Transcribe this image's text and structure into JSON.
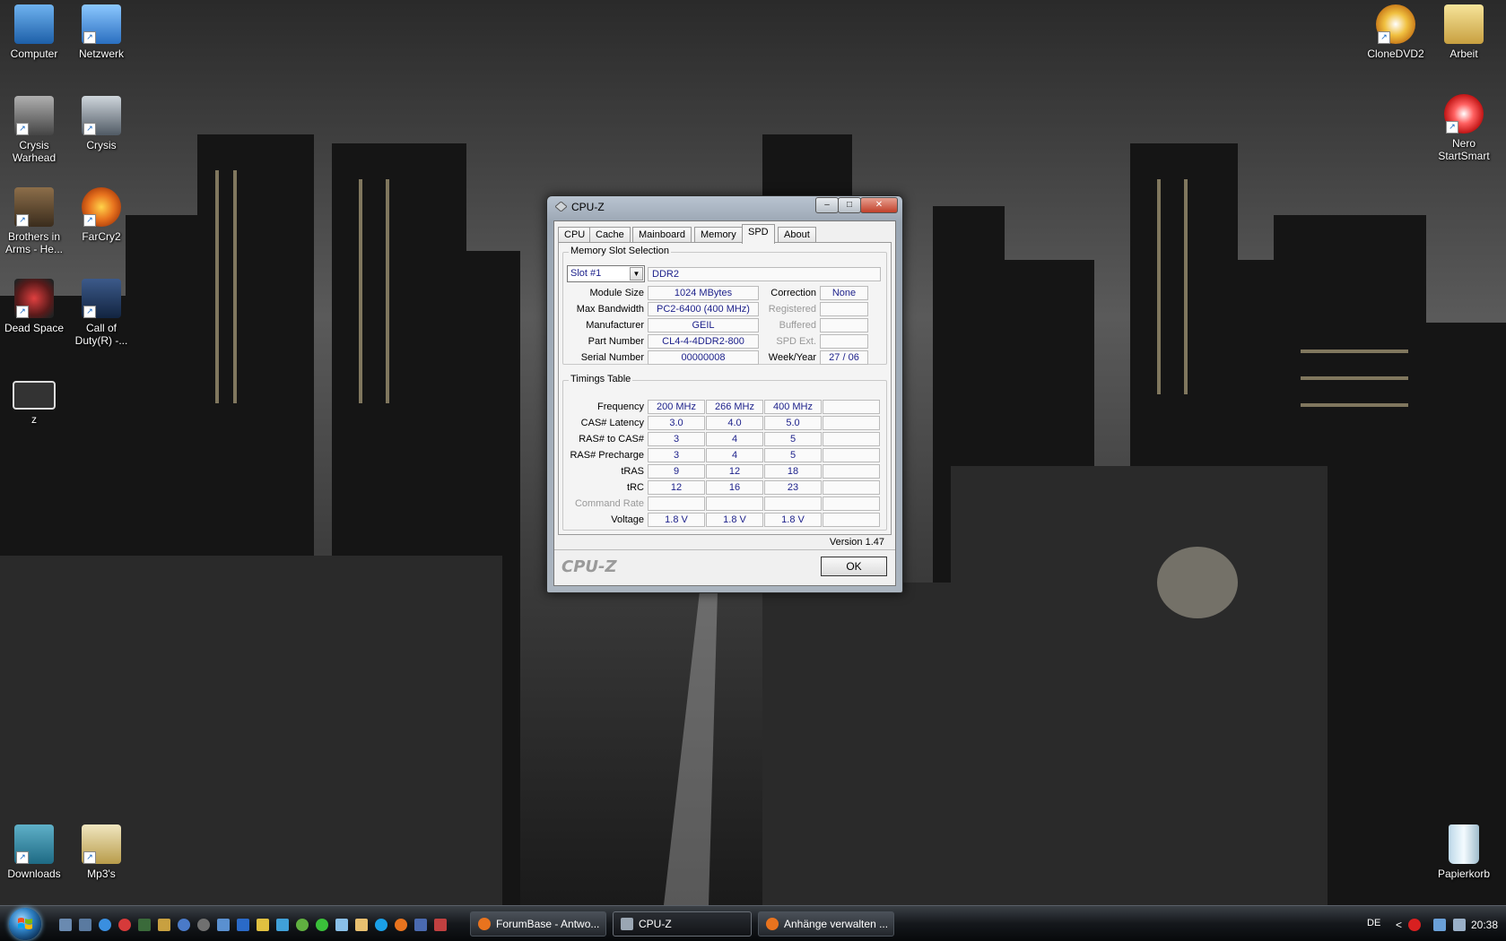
{
  "desktop": {
    "icons_left": [
      {
        "label": "Computer"
      },
      {
        "label": "Netzwerk"
      },
      {
        "label": "Crysis Warhead"
      },
      {
        "label": "Crysis"
      },
      {
        "label": "Brothers in Arms - He..."
      },
      {
        "label": "FarCry2"
      },
      {
        "label": "Dead Space"
      },
      {
        "label": "Call of Duty(R) -..."
      },
      {
        "label": "z"
      },
      {
        "label": "Downloads"
      },
      {
        "label": "Mp3's"
      }
    ],
    "icons_right": [
      {
        "label": "CloneDVD2"
      },
      {
        "label": "Arbeit"
      },
      {
        "label": "Nero StartSmart"
      },
      {
        "label": "Papierkorb"
      }
    ]
  },
  "window": {
    "title": "CPU-Z",
    "minimize": "–",
    "maximize": "□",
    "close": "✕",
    "tabs": [
      "CPU",
      "Cache",
      "Mainboard",
      "Memory",
      "SPD",
      "About"
    ],
    "active_tab": "SPD",
    "slot_group": {
      "title": "Memory Slot Selection",
      "slot": "Slot #1",
      "type": "DDR2",
      "rows": [
        {
          "label": "Module Size",
          "value": "1024 MBytes",
          "rlabel": "Correction",
          "rvalue": "None",
          "rdim": false
        },
        {
          "label": "Max Bandwidth",
          "value": "PC2-6400 (400 MHz)",
          "rlabel": "Registered",
          "rvalue": "",
          "rdim": true
        },
        {
          "label": "Manufacturer",
          "value": "GEIL",
          "rlabel": "Buffered",
          "rvalue": "",
          "rdim": true
        },
        {
          "label": "Part Number",
          "value": "CL4-4-4DDR2-800",
          "rlabel": "SPD Ext.",
          "rvalue": "",
          "rdim": true
        },
        {
          "label": "Serial Number",
          "value": "00000008",
          "rlabel": "Week/Year",
          "rvalue": "27 / 06",
          "rdim": false
        }
      ]
    },
    "timings": {
      "title": "Timings Table",
      "rows": [
        {
          "label": "Frequency",
          "values": [
            "200 MHz",
            "266 MHz",
            "400 MHz",
            ""
          ],
          "dim": false
        },
        {
          "label": "CAS# Latency",
          "values": [
            "3.0",
            "4.0",
            "5.0",
            ""
          ],
          "dim": false
        },
        {
          "label": "RAS# to CAS#",
          "values": [
            "3",
            "4",
            "5",
            ""
          ],
          "dim": false
        },
        {
          "label": "RAS# Precharge",
          "values": [
            "3",
            "4",
            "5",
            ""
          ],
          "dim": false
        },
        {
          "label": "tRAS",
          "values": [
            "9",
            "12",
            "18",
            ""
          ],
          "dim": false
        },
        {
          "label": "tRC",
          "values": [
            "12",
            "16",
            "23",
            ""
          ],
          "dim": false
        },
        {
          "label": "Command Rate",
          "values": [
            "",
            "",
            "",
            ""
          ],
          "dim": true
        },
        {
          "label": "Voltage",
          "values": [
            "1.8 V",
            "1.8 V",
            "1.8 V",
            ""
          ],
          "dim": false
        }
      ]
    },
    "version": "Version 1.47",
    "brand": "CPU-Z",
    "ok": "OK"
  },
  "taskbar": {
    "tasks": [
      {
        "label": "ForumBase - Antwo...",
        "active": false,
        "color": "#e8731e"
      },
      {
        "label": "CPU-Z",
        "active": true,
        "color": "#9aa6b3"
      },
      {
        "label": "Anhänge verwalten ...",
        "active": false,
        "color": "#e8731e"
      }
    ],
    "language": "DE",
    "tray_expand": "<",
    "clock": "20:38"
  },
  "colors": {
    "value_text": "#1b1f8a",
    "taskbar": "#15181c"
  }
}
